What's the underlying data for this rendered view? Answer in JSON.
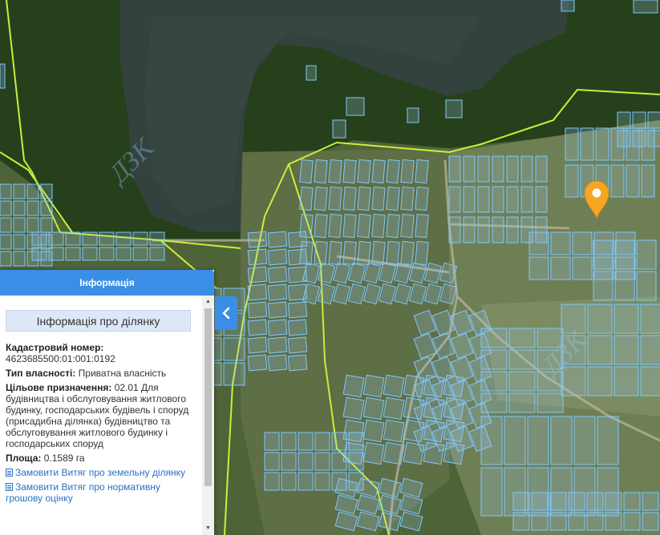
{
  "colors": {
    "accent": "#3a8ee6",
    "parcel_stroke": "#7ec8ff",
    "boundary_line": "#c8f03a",
    "marker": "#f5a623",
    "link": "#2a6fc4"
  },
  "watermark": "ДЗК",
  "panel": {
    "title": "Інформація",
    "subtitle": "Інформація про ділянку",
    "cadastral_label": "Кадастровий номер:",
    "cadastral_value": "4623685500:01:001:0192",
    "ownership_label": "Тип власності:",
    "ownership_value": "Приватна власність",
    "purpose_label": "Цільове призначення:",
    "purpose_value": "02.01 Для будівництва і обслуговування житлового будинку, господарських будівель і споруд (присадибна ділянка) будівництво та обслуговування житлового будинку і господарських споруд",
    "area_label": "Площа:",
    "area_value": "0.1589 га",
    "links": [
      "Замовити Витяг про земельну ділянку",
      "Замовити Витяг про нормативну грошову оцінку"
    ]
  },
  "icons": {
    "collapse": "chevron-left-icon",
    "marker": "location-pin-icon",
    "document": "document-icon"
  }
}
